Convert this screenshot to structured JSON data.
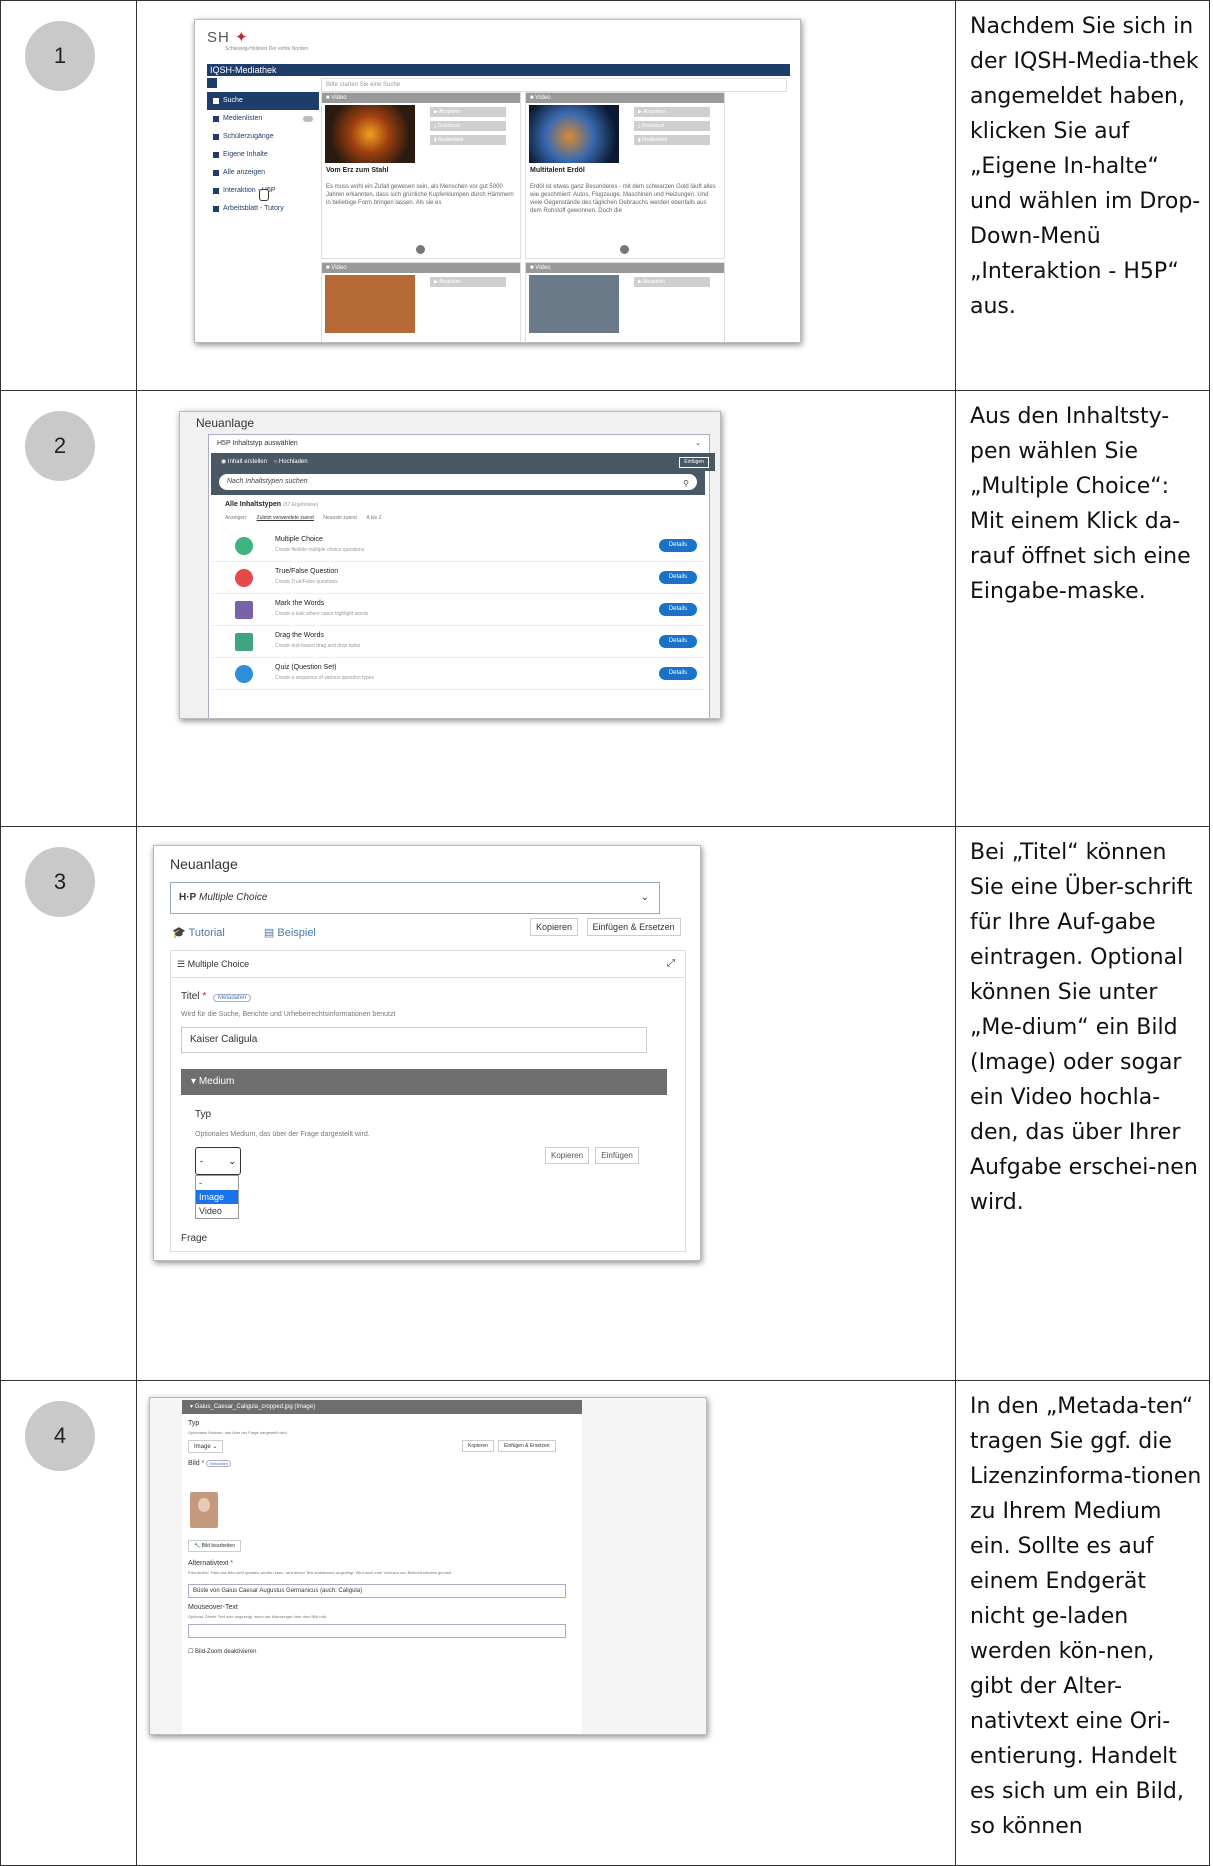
{
  "steps": [
    {
      "number": "1",
      "text": "Nachdem Sie sich in der IQSH-Media-thek angemeldet haben, klicken Sie auf „Eigene In-halte“ und wählen im Drop-Down-Menü „Interaktion - H5P“ aus."
    },
    {
      "number": "2",
      "text": "Aus den Inhaltsty-pen wählen Sie „Multiple Choice“: Mit einem Klick da-rauf öffnet sich eine Eingabe-maske."
    },
    {
      "number": "3",
      "text": "Bei „Titel“ können Sie eine Über-schrift für Ihre Auf-gabe eintragen. Optional können Sie unter „Me-dium“ ein Bild (Image) oder sogar ein Video hochla-den, das über Ihrer Aufgabe erschei-nen wird."
    },
    {
      "number": "4",
      "text": "In den „Metada-ten“ tragen Sie ggf. die Lizenzinforma-tionen zu Ihrem Medium ein. Sollte es auf einem Endgerät nicht ge-laden werden kön-nen, gibt der Alter-nativtext eine Ori-entierung. Handelt es sich um ein Bild, so können"
    }
  ],
  "s1": {
    "logo": "SH",
    "logo_sub": "Schleswig-Holstein Der echte Norden",
    "title": "IQSH-Mediathek",
    "search_placeholder": "Bitte starten Sie eine Suche",
    "menu": [
      "Suche",
      "Medienlisten",
      "Schülerzugänge",
      "Eigene Inhalte",
      "Alle anzeigen",
      "Interaktion - H5P",
      "Arbeitsblatt - Tutory"
    ],
    "cards": [
      {
        "tag": "Video",
        "title": "Vom Erz zum Stahl",
        "text": "Es muss wohl ein Zufall gewesen sein, als Menschen vor gut 5000 Jahren erkannten, dass sich grünliche Kupferklumpen durch Hämmern in beliebige Form bringen lassen. Als sie es"
      },
      {
        "tag": "Video",
        "title": "Multitalent Erdöl",
        "text": "Erdöl ist etwas ganz Besonderes - mit dem schwarzen Gold läuft alles wie geschmiert: Autos, Flugzeuge, Maschinen und Heizungen. Und viele Gegenstände des täglichen Gebrauchs werden ebenfalls aus dem Rohstoff gewonnen. Doch die"
      },
      {
        "tag": "Video"
      },
      {
        "tag": "Video"
      }
    ],
    "buttons": [
      "Abspielen",
      "Download",
      "Medienliste"
    ]
  },
  "s2": {
    "heading": "Neuanlage",
    "select": "H5P Inhaltstyp auswählen",
    "radio_create": "Inhalt erstellen",
    "radio_upload": "Hochladen",
    "paste": "Einfügen",
    "search": "Nach Inhaltstypen suchen",
    "all": "Alle Inhaltstypen",
    "all_count": "(57 Ergebnisse)",
    "show": "Anzeigen:",
    "sort": [
      "Zuletzt verwendete zuerst",
      "Neueste zuerst",
      "A bis Z"
    ],
    "details": "Details",
    "items": [
      {
        "title": "Multiple Choice",
        "desc": "Create flexible multiple choice questions",
        "color": "#3fb37f"
      },
      {
        "title": "True/False Question",
        "desc": "Create True/False questions",
        "color": "#e34b4b"
      },
      {
        "title": "Mark the Words",
        "desc": "Create a task where users highlight words",
        "color": "#7b61a8"
      },
      {
        "title": "Drag the Words",
        "desc": "Create text-based drag and drop tasks",
        "color": "#3fa37f"
      },
      {
        "title": "Quiz (Question Set)",
        "desc": "Create a sequence of various question types",
        "color": "#2f8ed8"
      }
    ]
  },
  "s3": {
    "heading": "Neuanlage",
    "select": "Multiple Choice",
    "tutorial": "Tutorial",
    "beispiel": "Beispiel",
    "kopieren": "Kopieren",
    "einfuegen_ersetzen": "Einfügen & Ersetzen",
    "box_title": "Multiple Choice",
    "titel": "Titel",
    "metadaten": "Metadaten",
    "titel_hint": "Wird für die Suche, Berichte und Urheberrechtsinformationen benutzt",
    "titel_value": "Kaiser Caligula",
    "medium": "Medium",
    "typ": "Typ",
    "typ_hint": "Optionales Medium, das über der Frage dargestellt wird.",
    "dd_value": "-",
    "options": [
      "-",
      "Image",
      "Video"
    ],
    "einfuegen": "Einfügen",
    "frage": "Frage"
  },
  "s4": {
    "header": "Gaius_Caesar_Caligula_cropped.jpg (Image)",
    "typ": "Typ",
    "typ_hint": "Optionales Medium, das über der Frage dargestellt wird.",
    "typ_value": "Image",
    "kopieren": "Kopieren",
    "einfuegen_ersetzen": "Einfügen & Ersetzen",
    "bild": "Bild",
    "metadaten": "Metadaten",
    "bild_bearbeiten": "Bild bearbeiten",
    "alt": "Alternativtext",
    "alt_hint": "Erforderlich. Falls das Bild nicht geladen werden kann, wird dieser Text stattdessen angezeigt. Wird auch zum Vorlesen von Bildschirmtexten genutzt.",
    "alt_value": "Büste von Gaius Caesar Augustus Germanicus (auch: Caligula)",
    "mouse": "Mouseover-Text",
    "mouse_hint": "Optional. Dieser Text wird angezeigt, wenn der Mauszeiger über dem Bild ruht.",
    "zoom": "Bild-Zoom deaktivieren"
  }
}
